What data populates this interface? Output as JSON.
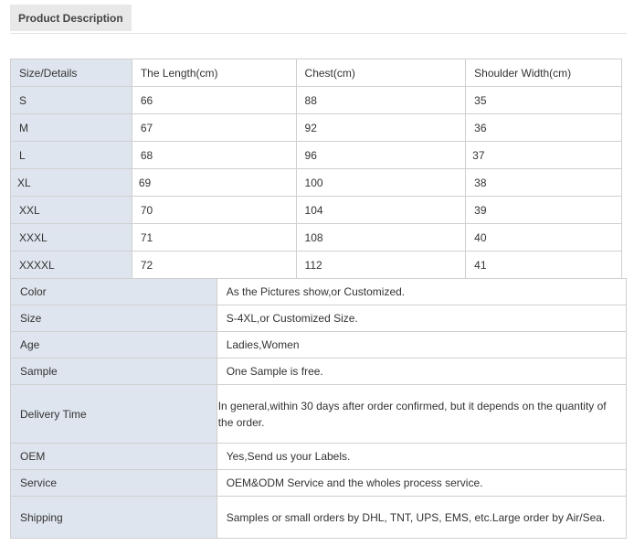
{
  "header": {
    "tab_label": "Product Description"
  },
  "size_table": {
    "headers": [
      "Size/Details",
      "The Length(cm)",
      "Chest(cm)",
      "Shoulder Width(cm)"
    ],
    "rows": [
      [
        "S",
        "66",
        "88",
        "35"
      ],
      [
        "M",
        "67",
        "92",
        "36"
      ],
      [
        "L",
        "68",
        "96",
        "37"
      ],
      [
        "XL",
        "69",
        "100",
        "38"
      ],
      [
        "XXL",
        "70",
        "104",
        "39"
      ],
      [
        "XXXL",
        "71",
        "108",
        "40"
      ],
      [
        "XXXXL",
        "72",
        "112",
        "41"
      ]
    ]
  },
  "info_table": [
    {
      "label": "Color",
      "value": "As the Pictures show,or Customized."
    },
    {
      "label": "Size",
      "value": "S-4XL,or Customized Size."
    },
    {
      "label": "Age",
      "value": "Ladies,Women"
    },
    {
      "label": "Sample",
      "value": "One Sample is free."
    },
    {
      "label": "Delivery Time",
      "value": "In general,within 30 days after order confirmed, but it depends on the quantity of the order."
    },
    {
      "label": "OEM",
      "value": "Yes,Send us your Labels."
    },
    {
      "label": "Service",
      "value": "OEM&ODM Service and the wholes process service."
    },
    {
      "label": "Shipping",
      "value": "Samples or small orders by DHL, TNT, UPS, EMS, etc.Large order by Air/Sea."
    }
  ],
  "colors": {
    "label_bg": "#dfe5ee",
    "border": "#cfcfcf",
    "tab_bg": "#e8e8e8"
  }
}
